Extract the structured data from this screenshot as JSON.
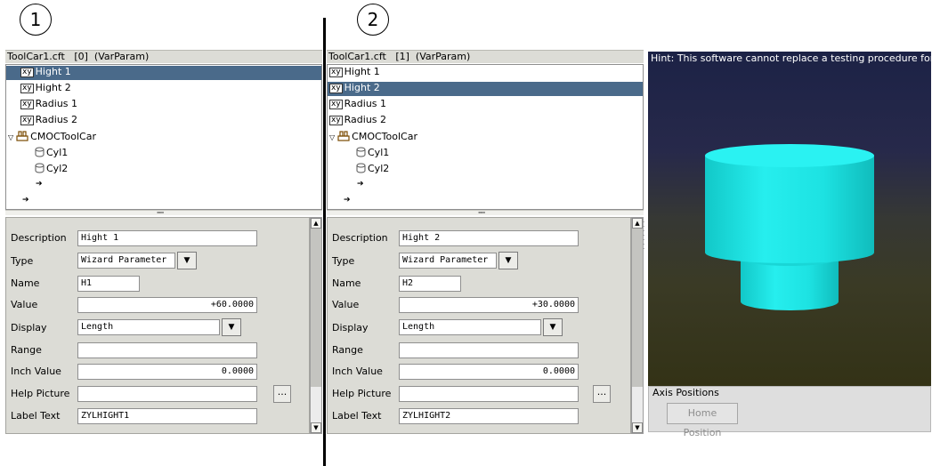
{
  "markers": [
    "1",
    "2"
  ],
  "panels": [
    {
      "title": "ToolCar1.cft   [0]  (VarParam)",
      "tree": [
        {
          "icon": "xy",
          "label": "Hight 1",
          "selected": true
        },
        {
          "icon": "xy",
          "label": "Hight 2"
        },
        {
          "icon": "xy",
          "label": "Radius 1"
        },
        {
          "icon": "xy",
          "label": "Radius 2"
        },
        {
          "icon": "toolcar",
          "label": "CMOCToolCar"
        },
        {
          "icon": "cylinder",
          "label": "Cyl1"
        },
        {
          "icon": "cylinder",
          "label": "Cyl2"
        }
      ],
      "props": {
        "description": {
          "label": "Description",
          "value": "Hight 1"
        },
        "type": {
          "label": "Type",
          "value": "Wizard Parameter"
        },
        "name": {
          "label": "Name",
          "value": "H1"
        },
        "value": {
          "label": "Value",
          "value": "+60.0000"
        },
        "display": {
          "label": "Display",
          "value": "Length"
        },
        "range": {
          "label": "Range",
          "value": ""
        },
        "inch_value": {
          "label": "Inch Value",
          "value": "0.0000"
        },
        "help_picture": {
          "label": "Help Picture",
          "value": "",
          "button": "..."
        },
        "label_text": {
          "label": "Label Text",
          "value": "ZYLHIGHT1"
        }
      }
    },
    {
      "title": "ToolCar1.cft   [1]  (VarParam)",
      "tree": [
        {
          "icon": "xy",
          "label": "Hight 1"
        },
        {
          "icon": "xy",
          "label": "Hight 2",
          "selected": true
        },
        {
          "icon": "xy",
          "label": "Radius 1"
        },
        {
          "icon": "xy",
          "label": "Radius 2"
        },
        {
          "icon": "toolcar",
          "label": "CMOCToolCar"
        },
        {
          "icon": "cylinder",
          "label": "Cyl1"
        },
        {
          "icon": "cylinder",
          "label": "Cyl2"
        }
      ],
      "props": {
        "description": {
          "label": "Description",
          "value": "Hight 2"
        },
        "type": {
          "label": "Type",
          "value": "Wizard Parameter"
        },
        "name": {
          "label": "Name",
          "value": "H2"
        },
        "value": {
          "label": "Value",
          "value": "+30.0000"
        },
        "display": {
          "label": "Display",
          "value": "Length"
        },
        "range": {
          "label": "Range",
          "value": ""
        },
        "inch_value": {
          "label": "Inch Value",
          "value": "0.0000"
        },
        "help_picture": {
          "label": "Help Picture",
          "value": "",
          "button": "..."
        },
        "label_text": {
          "label": "Label Text",
          "value": "ZYLHIGHT2"
        }
      }
    }
  ],
  "viewer": {
    "hint": "Hint: This software cannot replace a testing procedure for DCM",
    "model_color": "#1fe0e0",
    "axis_panel_title": "Axis Positions",
    "home_button": "Home Position"
  }
}
